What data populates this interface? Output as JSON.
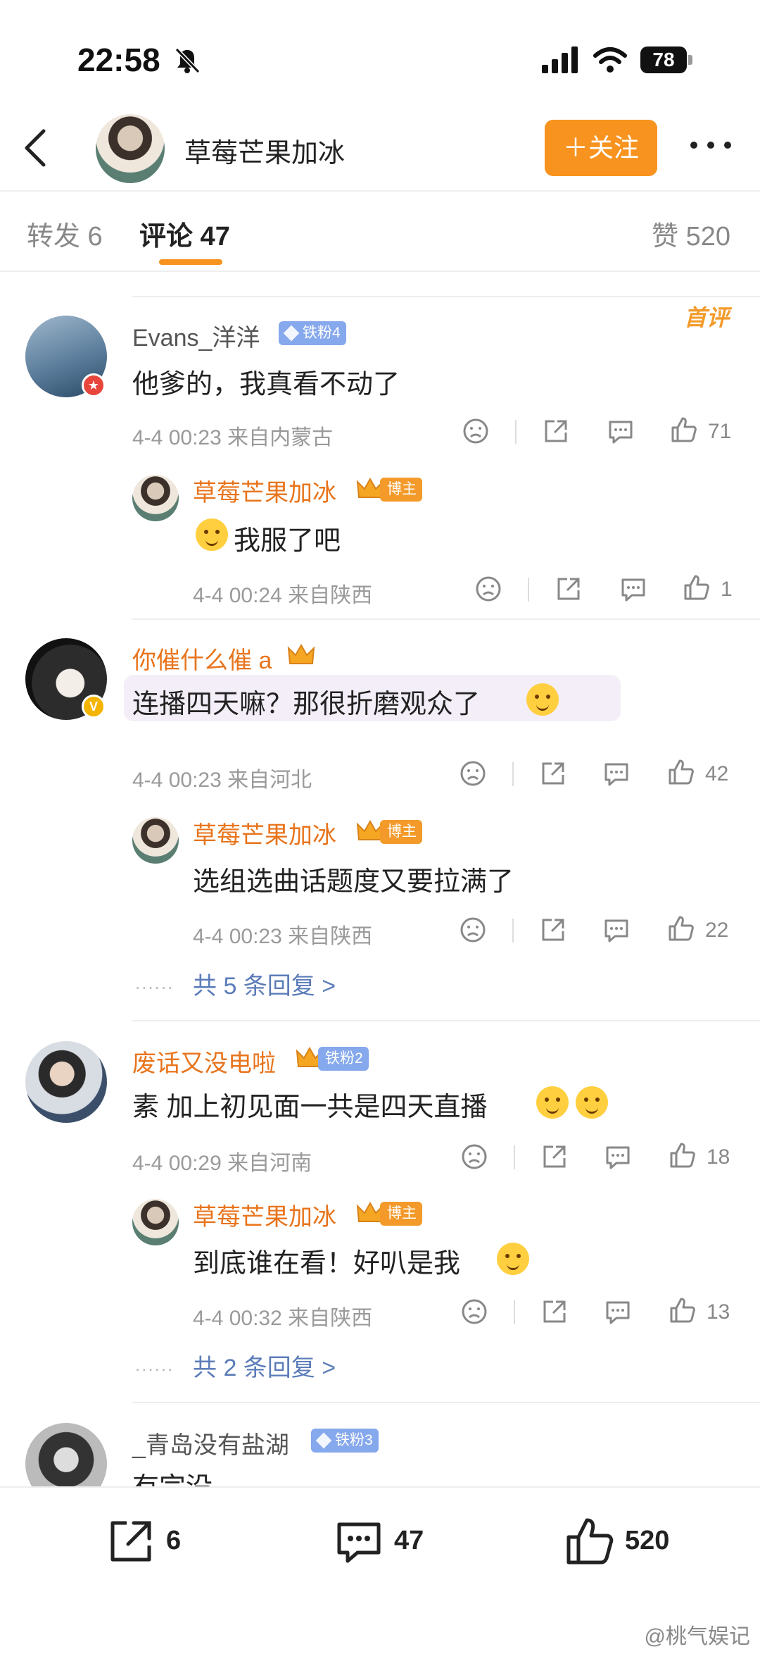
{
  "status_bar": {
    "time": "22:58",
    "battery": "78"
  },
  "header": {
    "name": "草莓芒果加冰",
    "follow_label": "＋关注"
  },
  "tabs": {
    "repost": "转发 6",
    "comments": "评论 47",
    "likes": "赞 520"
  },
  "comments": [
    {
      "user": "Evans_洋洋",
      "badge": "铁粉4",
      "tag": "首评",
      "text": "他爹的，我真看不动了",
      "meta": "4-4 00:23  来自内蒙古",
      "likes": "71",
      "replies": [
        {
          "user": "草莓芒果加冰",
          "badge": "博主",
          "text": "我服了吧",
          "meta": "4-4 00:24  来自陕西",
          "likes": "1"
        }
      ]
    },
    {
      "user": "你催什么催 a",
      "text": "连播四天嘛？那很折磨观众了",
      "meta": "4-4 00:23  来自河北",
      "likes": "42",
      "replies": [
        {
          "user": "草莓芒果加冰",
          "badge": "博主",
          "text": "选组选曲话题度又要拉满了",
          "meta": "4-4 00:23  来自陕西",
          "likes": "22"
        }
      ],
      "more": "共 5 条回复 >"
    },
    {
      "user": "废话又没电啦",
      "badge": "铁粉2",
      "text": "素 加上初见面一共是四天直播",
      "meta": "4-4 00:29  来自河南",
      "likes": "18",
      "replies": [
        {
          "user": "草莓芒果加冰",
          "badge": "博主",
          "text": "到底谁在看！好叭是我",
          "meta": "4-4 00:32  来自陕西",
          "likes": "13"
        }
      ],
      "more": "共 2 条回复 >"
    },
    {
      "user": "_青岛没有盐湖",
      "badge": "铁粉3",
      "text": "有完没"
    }
  ],
  "bottom_bar": {
    "reposts": "6",
    "comments": "47",
    "likes": "520"
  },
  "watermark": "@桃气娱记"
}
